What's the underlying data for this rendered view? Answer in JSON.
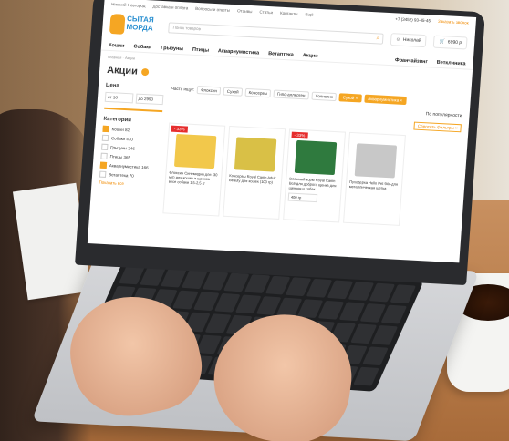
{
  "topbar": {
    "city": "Нижний Новгород",
    "links": [
      "Доставка и оплата",
      "Вопросы и ответы",
      "Отзывы",
      "Статьи",
      "Контакты",
      "Ещё"
    ],
    "phone": "+7 (3452) 93-45-45",
    "callback": "Заказать звонок"
  },
  "logo": {
    "line1": "СЫТАЯ",
    "line2": "МОРДА"
  },
  "search": {
    "placeholder": "Поиск товаров"
  },
  "user": {
    "label": "Николай"
  },
  "cart": {
    "label": "6990 р",
    "count": "4"
  },
  "nav": {
    "items": [
      "Кошки",
      "Собаки",
      "Грызуны",
      "Птицы",
      "Аквариумистика",
      "Ветаптека",
      "Акции"
    ],
    "right": [
      "Франчайзинг",
      "Ветклиника"
    ]
  },
  "breadcrumb": "Главная · Акции",
  "page": {
    "title": "Акции"
  },
  "sidebar": {
    "price_title": "Цена",
    "price_from": "от 16",
    "price_to": "до 2990",
    "categories_title": "Категории",
    "categories": [
      {
        "label": "Кошки 82",
        "checked": true
      },
      {
        "label": "Собаки 470",
        "checked": false
      },
      {
        "label": "Грызуны 246",
        "checked": false
      },
      {
        "label": "Птицы 365",
        "checked": false
      },
      {
        "label": "Аквариумистика 166",
        "checked": true
      },
      {
        "label": "Ветаптека 70",
        "checked": false
      }
    ],
    "show_all": "Показать все"
  },
  "filters": {
    "label": "Часто ищут:",
    "chips": [
      "Флоксин",
      "Сухой",
      "Консервы",
      "Гипо-аллерген",
      "Холистик"
    ],
    "active": [
      "Сухой ×",
      "Аквариумистика ×"
    ]
  },
  "sort": {
    "label": "По популярности",
    "reset": "Сбросить фильтры ×"
  },
  "products": [
    {
      "sale": "- 33%",
      "name": "Флоксин Синемидин для (30 мл) для кошек и щенков весе собаки 1,5-2,5 кг",
      "color": "#f2c84b",
      "weight": ""
    },
    {
      "sale": "",
      "name": "Консервы Royal Canin Adult Beauty для кошек (100 гр)",
      "color": "#d9c046",
      "weight": ""
    },
    {
      "sale": "- 33%",
      "name": "Влажный корм Royal Canin Всё для доброго щенка для щенков и собак",
      "color": "#2f7a3e",
      "weight": "400 гр"
    },
    {
      "sale": "",
      "name": "Пуходерка Hello Pet 94х-для металлическая щетка",
      "color": "#c8c8c8",
      "weight": ""
    }
  ]
}
